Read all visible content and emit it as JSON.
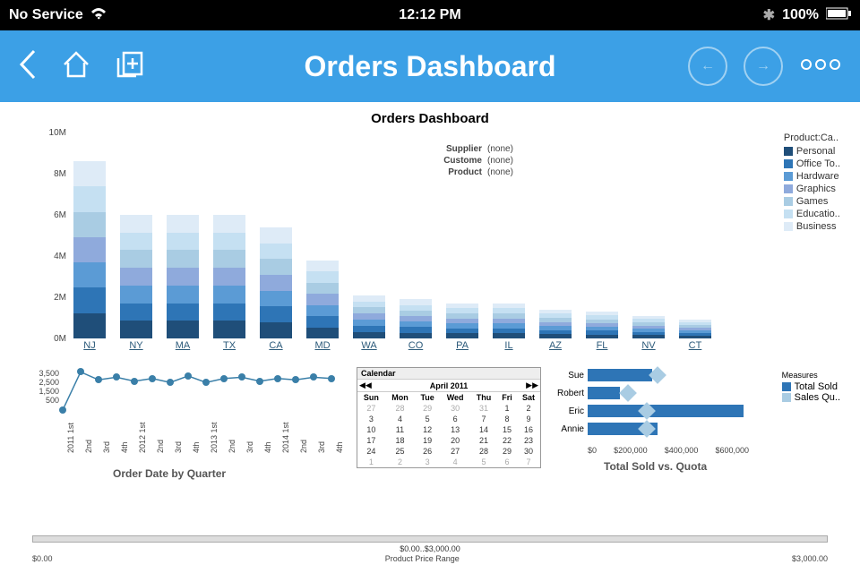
{
  "status": {
    "carrier": "No Service",
    "time": "12:12 PM",
    "battery": "100%"
  },
  "navbar": {
    "title": "Orders Dashboard"
  },
  "page_title": "Orders Dashboard",
  "filters": [
    {
      "label": "Supplier",
      "value": "(none)"
    },
    {
      "label": "Custome",
      "value": "(none)"
    },
    {
      "label": "Product",
      "value": "(none)"
    }
  ],
  "legend": {
    "title": "Product:Ca..",
    "items": [
      {
        "label": "Personal",
        "color": "#1f4e79"
      },
      {
        "label": "Office To..",
        "color": "#2e75b6"
      },
      {
        "label": "Hardware",
        "color": "#5b9bd5"
      },
      {
        "label": "Graphics",
        "color": "#8faadc"
      },
      {
        "label": "Games",
        "color": "#a9cce3"
      },
      {
        "label": "Educatio..",
        "color": "#c5e0f2"
      },
      {
        "label": "Business",
        "color": "#deebf7"
      }
    ]
  },
  "chart_data": [
    {
      "type": "bar-stacked",
      "title": "State totals",
      "ylabel": "",
      "ylim": [
        0,
        10000000
      ],
      "yticks": [
        "0M",
        "2M",
        "4M",
        "6M",
        "8M",
        "10M"
      ],
      "categories": [
        "NJ",
        "NY",
        "MA",
        "TX",
        "CA",
        "MD",
        "WA",
        "CO",
        "PA",
        "IL",
        "AZ",
        "FL",
        "NV",
        "CT"
      ],
      "totals": [
        8.6,
        6.0,
        6.0,
        6.0,
        5.4,
        3.8,
        2.1,
        1.9,
        1.7,
        1.7,
        1.4,
        1.3,
        1.1,
        0.9
      ],
      "series_order": [
        "Business",
        "Educatio..",
        "Games",
        "Graphics",
        "Hardware",
        "Office To..",
        "Personal"
      ]
    },
    {
      "type": "line",
      "title": "Order Date by Quarter",
      "x": [
        "2011 1st",
        "2nd",
        "3rd",
        "4th",
        "2012 1st",
        "2nd",
        "3rd",
        "4th",
        "2013 1st",
        "2nd",
        "3rd",
        "4th",
        "2014 1st",
        "2nd",
        "3rd",
        "4th"
      ],
      "y": [
        500,
        3400,
        2800,
        3000,
        2700,
        2900,
        2600,
        3100,
        2600,
        2900,
        3000,
        2700,
        2900,
        2800,
        3000,
        2900
      ],
      "ylim": [
        500,
        3500
      ],
      "yticks": [
        "500",
        "1,500",
        "2,500",
        "3,500"
      ]
    },
    {
      "type": "bar-horizontal",
      "title": "Total Sold vs. Quota",
      "xlabel": "",
      "xlim": [
        0,
        600000
      ],
      "xticks": [
        "$0",
        "$200,000",
        "$400,000",
        "$600,000"
      ],
      "categories": [
        "Sue",
        "Robert",
        "Eric",
        "Annie"
      ],
      "series": [
        {
          "name": "Total Sold",
          "values": [
            240000,
            120000,
            580000,
            260000
          ],
          "color": "#2e75b6"
        },
        {
          "name": "Sales Qu..",
          "values": [
            260000,
            150000,
            220000,
            220000
          ],
          "color": "#a9cce3"
        }
      ]
    }
  ],
  "measures_legend": {
    "title": "Measures",
    "items": [
      {
        "label": "Total Sold",
        "color": "#2e75b6"
      },
      {
        "label": "Sales Qu..",
        "color": "#a9cce3"
      }
    ]
  },
  "calendar": {
    "title": "Calendar",
    "month": "April 2011",
    "dow": [
      "Sun",
      "Mon",
      "Tue",
      "Wed",
      "Thu",
      "Fri",
      "Sat"
    ],
    "rows": [
      [
        {
          "d": 27,
          "g": 1
        },
        {
          "d": 28,
          "g": 1
        },
        {
          "d": 29,
          "g": 1
        },
        {
          "d": 30,
          "g": 1
        },
        {
          "d": 31,
          "g": 1
        },
        {
          "d": 1
        },
        {
          "d": 2
        }
      ],
      [
        {
          "d": 3
        },
        {
          "d": 4
        },
        {
          "d": 5
        },
        {
          "d": 6
        },
        {
          "d": 7
        },
        {
          "d": 8
        },
        {
          "d": 9
        }
      ],
      [
        {
          "d": 10
        },
        {
          "d": 11
        },
        {
          "d": 12
        },
        {
          "d": 13
        },
        {
          "d": 14
        },
        {
          "d": 15
        },
        {
          "d": 16
        }
      ],
      [
        {
          "d": 17
        },
        {
          "d": 18
        },
        {
          "d": 19
        },
        {
          "d": 20
        },
        {
          "d": 21
        },
        {
          "d": 22
        },
        {
          "d": 23
        }
      ],
      [
        {
          "d": 24
        },
        {
          "d": 25
        },
        {
          "d": 26
        },
        {
          "d": 27
        },
        {
          "d": 28
        },
        {
          "d": 29
        },
        {
          "d": 30
        }
      ],
      [
        {
          "d": 1,
          "g": 1
        },
        {
          "d": 2,
          "g": 1
        },
        {
          "d": 3,
          "g": 1
        },
        {
          "d": 4,
          "g": 1
        },
        {
          "d": 5,
          "g": 1
        },
        {
          "d": 6,
          "g": 1
        },
        {
          "d": 7,
          "g": 1
        }
      ]
    ]
  },
  "slider": {
    "min": "$0.00",
    "max": "$3,000.00",
    "caption": "$0.00..$3,000.00",
    "label": "Product Price Range"
  }
}
